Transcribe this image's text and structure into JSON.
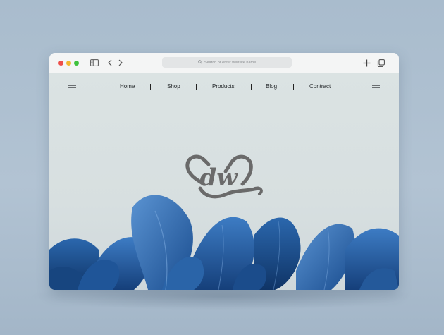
{
  "browser": {
    "search_placeholder": "Search or enter website name",
    "icons": [
      "sidebar-icon",
      "chevron-left-icon",
      "chevron-right-icon",
      "plus-icon",
      "tabs-icon"
    ]
  },
  "nav": {
    "items": [
      "Home",
      "Shop",
      "Products",
      "Blog",
      "Contract"
    ]
  },
  "logo": {
    "text": "dw"
  },
  "colors": {
    "page_bg": "#d9e2e3",
    "petal_blue": "#1e5fa8",
    "logo_gray": "#6a6a6a"
  }
}
